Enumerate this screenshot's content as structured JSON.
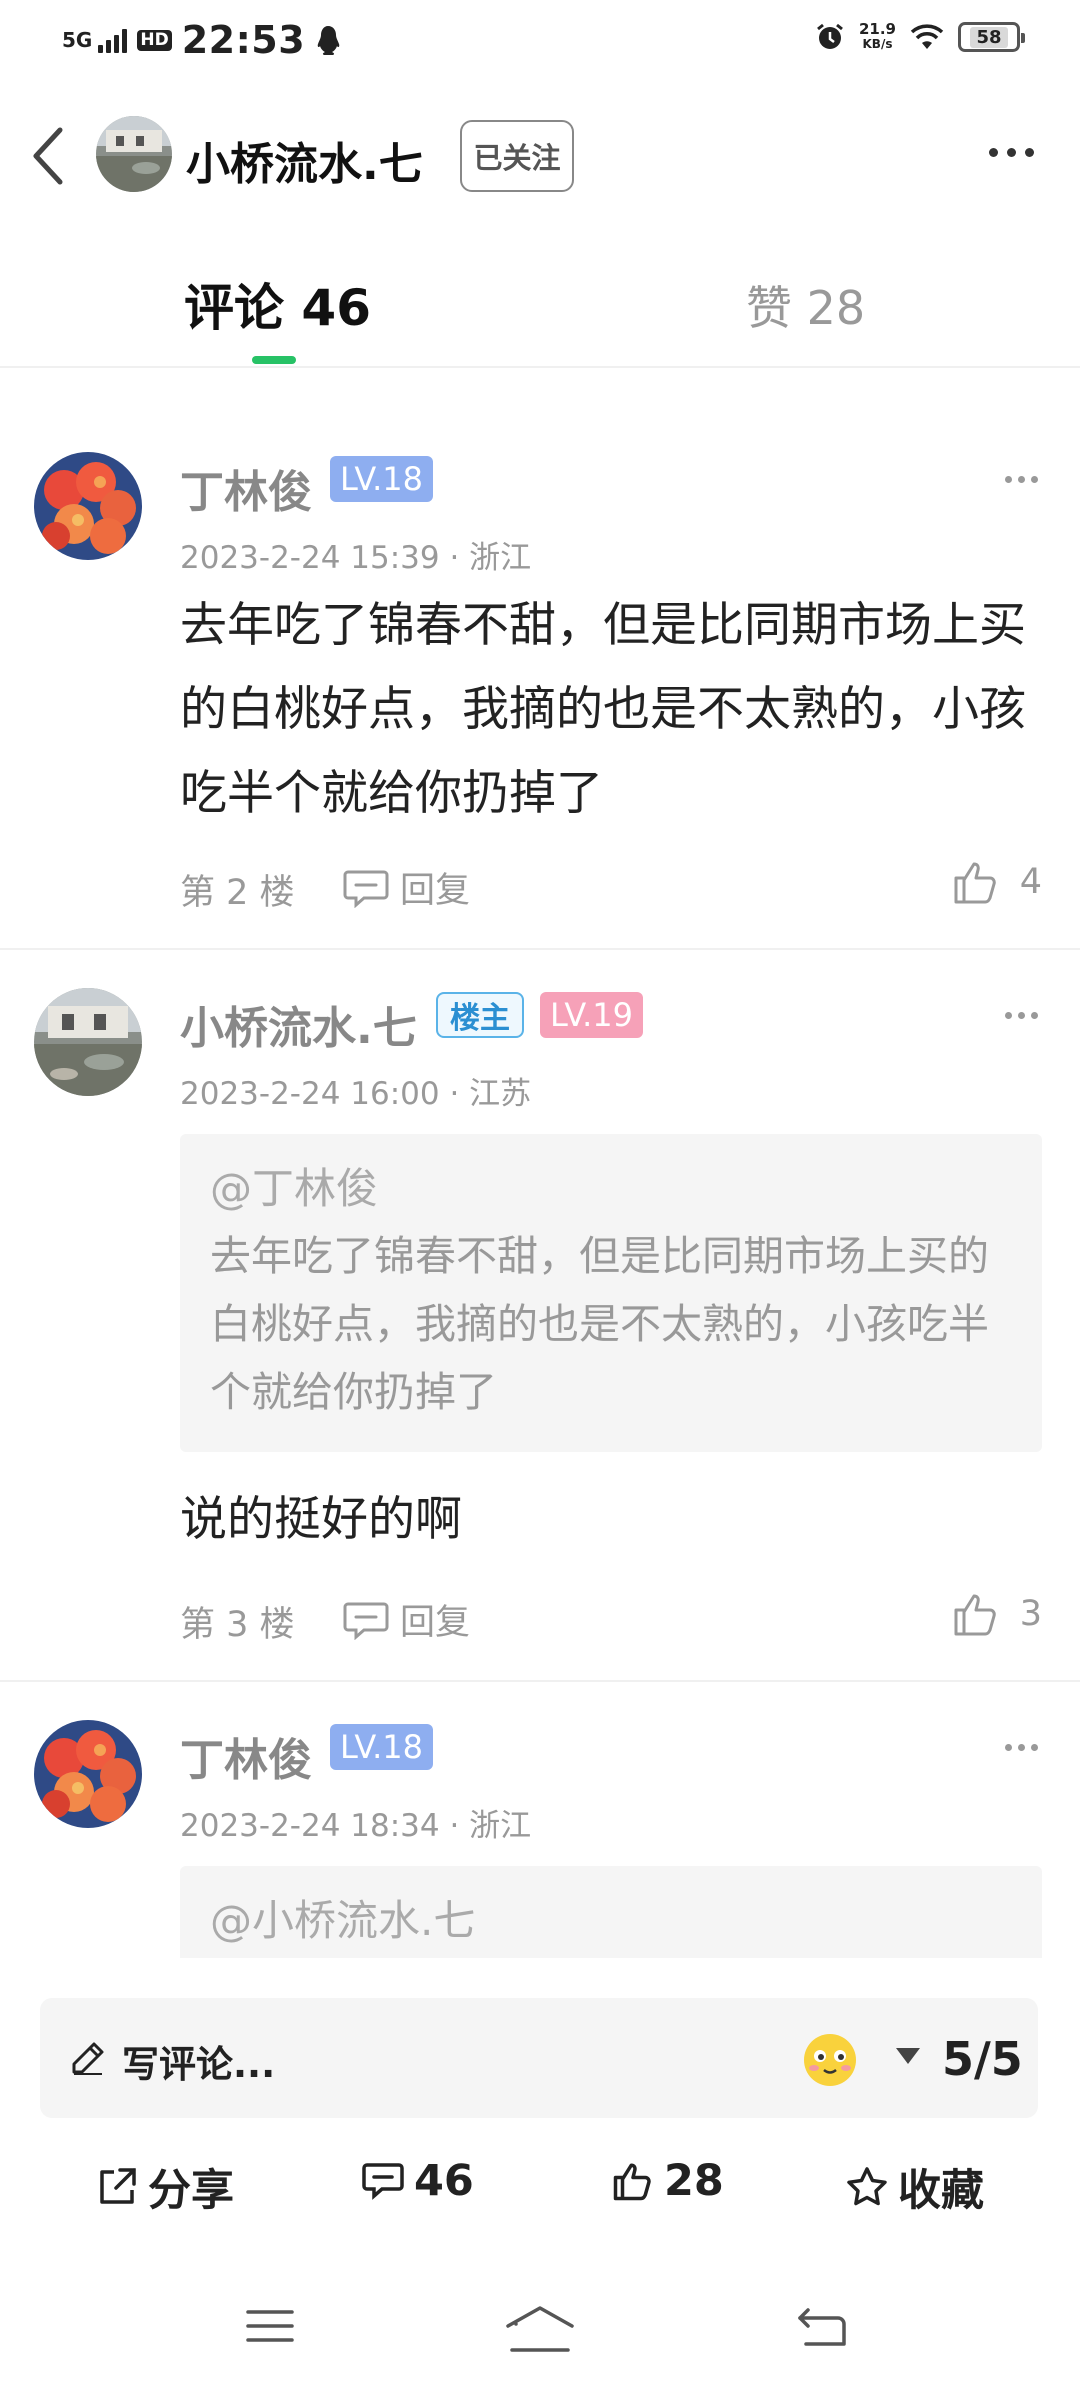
{
  "status_bar": {
    "network": "5G",
    "hd": "HD",
    "time": "22:53",
    "speed_value": "21.9",
    "speed_unit": "KB/s",
    "battery": "58"
  },
  "header": {
    "title": "小桥流水.七",
    "follow_label": "已关注"
  },
  "tabs": {
    "comments": "评论 46",
    "likes": "赞 28"
  },
  "comments": [
    {
      "author": "丁林俊",
      "level": "LV.18",
      "meta": "2023-2-24 15:39 · 浙江",
      "text": "去年吃了锦春不甜，但是比同期市场上买的白桃好点，我摘的也是不太熟的，小孩吃半个就给你扔掉了",
      "floor": "第 2 楼",
      "reply_label": "回复",
      "likes": "4"
    },
    {
      "author": "小桥流水.七",
      "owner_badge": "楼主",
      "level": "LV.19",
      "meta": "2023-2-24 16:00 · 江苏",
      "quote_author": "@丁林俊",
      "quote_text": "去年吃了锦春不甜，但是比同期市场上买的白桃好点，我摘的也是不太熟的，小孩吃半个就给你扔掉了",
      "text": "说的挺好的啊",
      "floor": "第 3 楼",
      "reply_label": "回复",
      "likes": "3"
    },
    {
      "author": "丁林俊",
      "level": "LV.18",
      "meta": "2023-2-24 18:34 · 浙江",
      "quote_author": "@小桥流水.七"
    }
  ],
  "bottom_bar": {
    "input_placeholder": "写评论...",
    "page_counter": "5/5",
    "share_label": "分享",
    "comment_count": "46",
    "like_count": "28",
    "favorite_label": "收藏"
  },
  "colors": {
    "accent_green": "#27c266",
    "level_blue": "#8eaef0",
    "level_pink": "#f6a1b8",
    "owner_blue": "#2b8fd2"
  }
}
